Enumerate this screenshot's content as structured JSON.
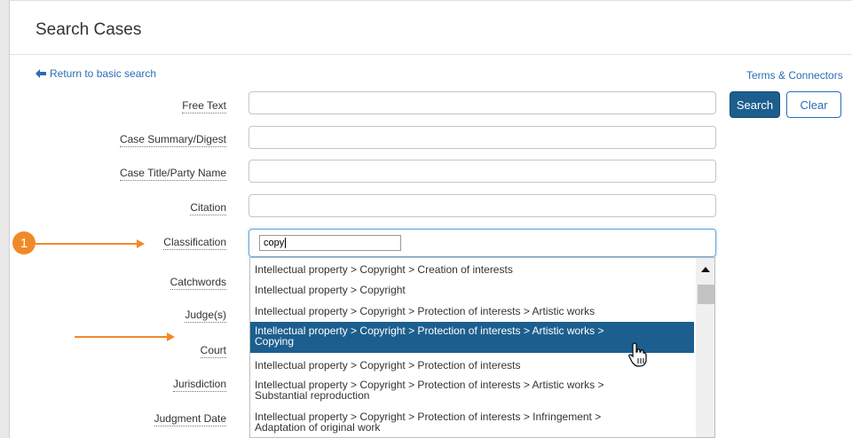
{
  "page": {
    "title": "Search Cases"
  },
  "links": {
    "back": "Return to basic search",
    "terms": "Terms & Connectors"
  },
  "buttons": {
    "search": "Search",
    "clear": "Clear"
  },
  "fields": {
    "free_text": "Free Text",
    "case_summary": "Case Summary/Digest",
    "case_title": "Case Title/Party Name",
    "citation": "Citation",
    "classification": "Classification",
    "catchwords": "Catchwords",
    "judges": "Judge(s)",
    "court": "Court",
    "jurisdiction": "Jurisdiction",
    "judgment_date": "Judgment Date"
  },
  "classification": {
    "input_value": "copy"
  },
  "dropdown": {
    "options": [
      "Intellectual property > Copyright > Creation of interests",
      "Intellectual property > Copyright",
      "Intellectual property > Copyright > Protection of interests > Artistic works",
      "Intellectual property > Copyright > Protection of interests > Artistic works > Copying",
      "Intellectual property > Copyright > Protection of interests",
      "Intellectual property > Copyright > Protection of interests > Artistic works > Substantial reproduction",
      "Intellectual property > Copyright > Protection of interests > Infringement > Adaptation of original work"
    ],
    "selected_index": 3
  },
  "annotation": {
    "marker": "1"
  },
  "colors": {
    "accent": "#1c5f8e",
    "link": "#2a6eb5",
    "annotation": "#f08a28"
  }
}
